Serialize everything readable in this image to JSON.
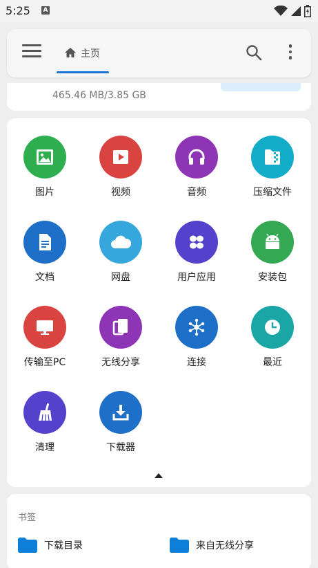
{
  "status_bar": {
    "time": "5:25",
    "notification_badge": "A"
  },
  "appbar": {
    "menu_icon": "menu-icon",
    "home_tab_label": "主页",
    "search_icon": "search-icon",
    "more_icon": "more-vert-icon"
  },
  "storage": {
    "text": "465.46 MB/3.85 GB"
  },
  "categories": [
    {
      "label": "图片",
      "icon": "image-icon",
      "color": "#2fae4f"
    },
    {
      "label": "视频",
      "icon": "video-icon",
      "color": "#d94441"
    },
    {
      "label": "音频",
      "icon": "headphones-icon",
      "color": "#8e35b5"
    },
    {
      "label": "压缩文件",
      "icon": "zip-icon",
      "color": "#12acc8"
    },
    {
      "label": "文档",
      "icon": "document-icon",
      "color": "#1e6fc7"
    },
    {
      "label": "网盘",
      "icon": "cloud-icon",
      "color": "#36a7dd"
    },
    {
      "label": "用户应用",
      "icon": "apps-icon",
      "color": "#5542cc"
    },
    {
      "label": "安装包",
      "icon": "android-icon",
      "color": "#34a853"
    },
    {
      "label": "传输至PC",
      "icon": "monitor-icon",
      "color": "#d94441"
    },
    {
      "label": "无线分享",
      "icon": "share-icon",
      "color": "#8e35b5"
    },
    {
      "label": "连接",
      "icon": "network-icon",
      "color": "#1e6fc7"
    },
    {
      "label": "最近",
      "icon": "clock-icon",
      "color": "#1ba6a6"
    },
    {
      "label": "清理",
      "icon": "broom-icon",
      "color": "#5542cc"
    },
    {
      "label": "下载器",
      "icon": "download-icon",
      "color": "#1e6fc7"
    }
  ],
  "bookmarks": {
    "title": "书签",
    "items": [
      {
        "label": "下载目录",
        "icon": "folder-icon"
      },
      {
        "label": "来自无线分享",
        "icon": "folder-icon"
      }
    ],
    "folder_color": "#0d7fd8"
  }
}
